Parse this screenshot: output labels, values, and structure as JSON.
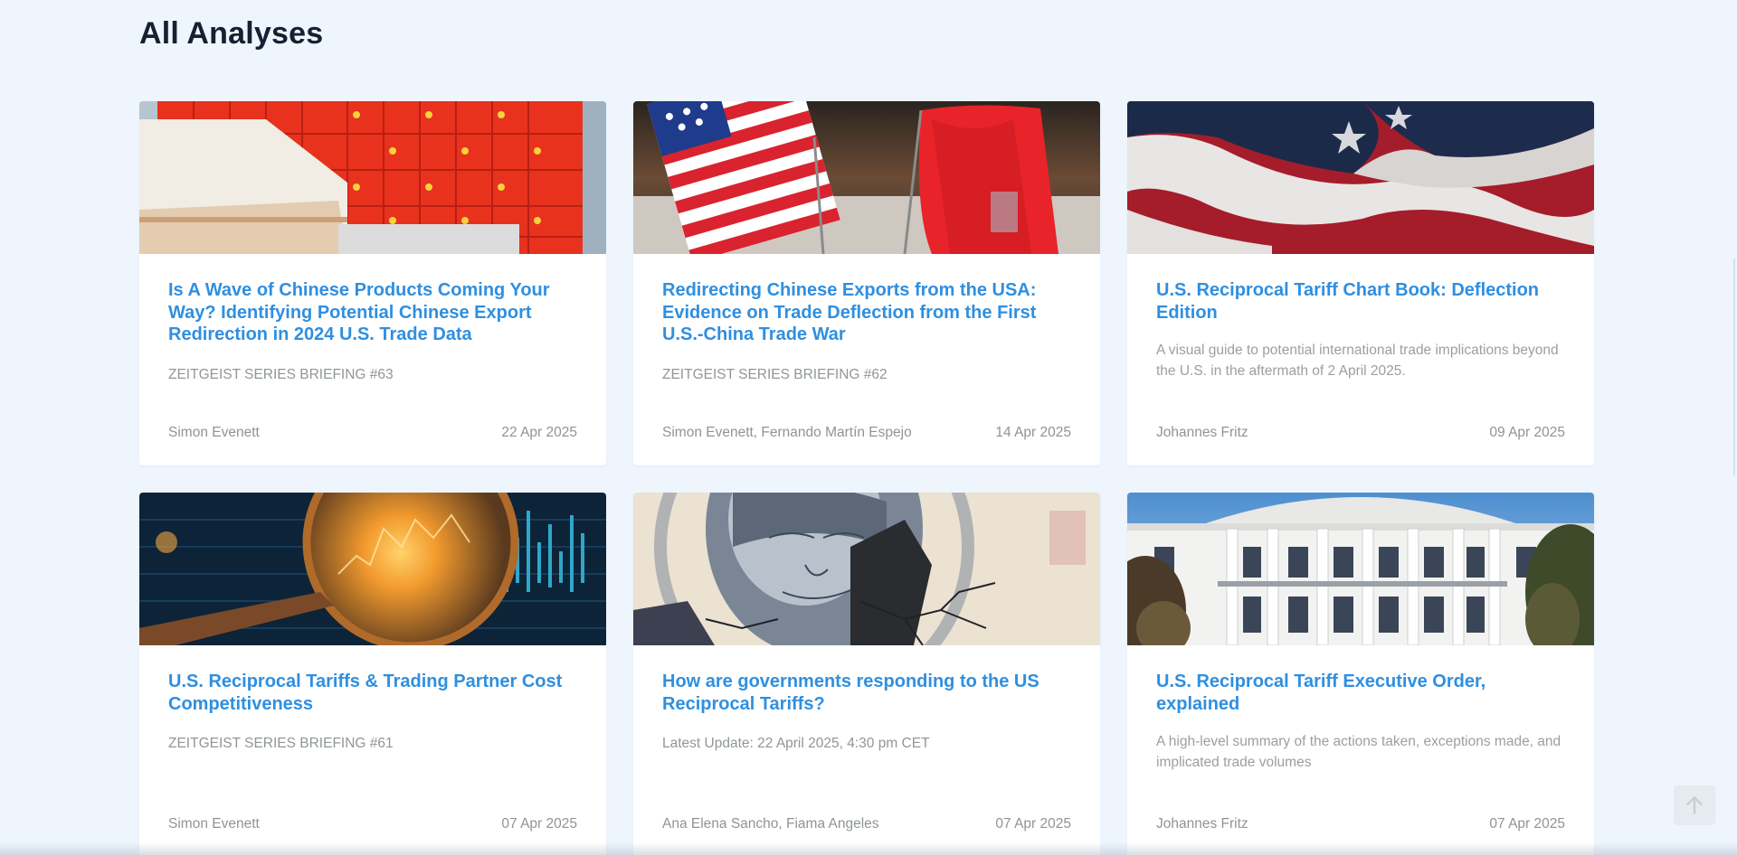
{
  "page": {
    "heading": "All Analyses"
  },
  "cards": [
    {
      "title": "Is A Wave of Chinese Products Coming Your Way? Identifying Potential Chinese Export Redirection in 2024 U.S. Trade Data",
      "subtitle": "ZEITGEIST SERIES BRIEFING #63",
      "authors": "Simon Evenett",
      "date": "22 Apr 2025"
    },
    {
      "title": "Redirecting Chinese Exports from the USA: Evidence on Trade Deflection from the First U.S.-China Trade War",
      "subtitle": "ZEITGEIST SERIES BRIEFING #62",
      "authors": "Simon Evenett, Fernando Martín Espejo",
      "date": "14 Apr 2025"
    },
    {
      "title": "U.S. Reciprocal Tariff Chart Book: Deflection Edition",
      "subtitle": "A visual guide to potential international trade implications beyond the U.S. in the aftermath of 2 April 2025.",
      "authors": "Johannes Fritz",
      "date": "09 Apr 2025"
    },
    {
      "title": "U.S. Reciprocal Tariffs & Trading Partner Cost Competitiveness",
      "subtitle": "ZEITGEIST SERIES BRIEFING #61",
      "authors": "Simon Evenett",
      "date": "07 Apr 2025"
    },
    {
      "title": "How are governments responding to the US Reciprocal Tariffs?",
      "subtitle": "Latest Update: 22 April 2025, 4:30 pm CET",
      "authors": "Ana Elena Sancho, Fiama Angeles",
      "date": "07 Apr 2025"
    },
    {
      "title": "U.S. Reciprocal Tariff Executive Order, explained",
      "subtitle": "A high-level summary of the actions taken, exceptions made, and implicated trade volumes",
      "authors": "Johannes Fritz",
      "date": "07 Apr 2025"
    }
  ],
  "icons": {
    "scroll_top": "arrow-up-icon"
  },
  "colors": {
    "background": "#eef5fd",
    "heading": "#162033",
    "link": "#2f8fe0",
    "muted": "#909699"
  }
}
